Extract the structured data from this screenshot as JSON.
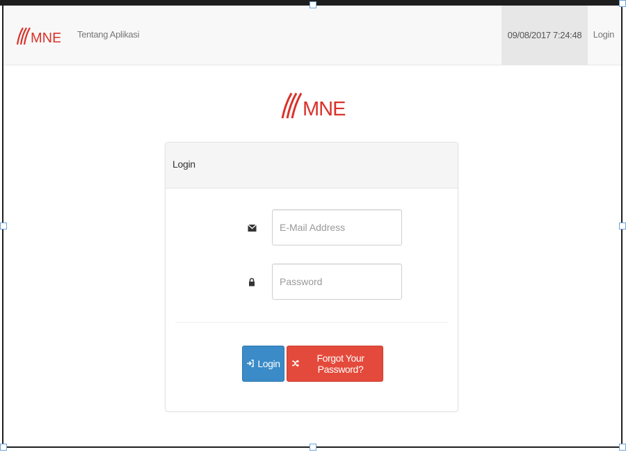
{
  "navbar": {
    "brand": "MNE",
    "about_label": "Tentang Aplikasi",
    "datetime": "09/08/2017 7:24:48",
    "login_label": "Login"
  },
  "logo": {
    "text": "MNE"
  },
  "panel": {
    "heading": "Login",
    "email": {
      "placeholder": "E-Mail Address",
      "value": "",
      "icon": "envelope-icon"
    },
    "password": {
      "placeholder": "Password",
      "value": "",
      "icon": "lock-icon"
    },
    "login_button": {
      "label": "Login",
      "icon": "sign-in-icon"
    },
    "forgot_button": {
      "label": "Forgot Your Password?",
      "icon": "shuffle-icon"
    }
  },
  "colors": {
    "brand_red": "#d9322b",
    "brand_dark": "#222222",
    "primary": "#3a8bc8",
    "danger": "#e44a3b"
  }
}
